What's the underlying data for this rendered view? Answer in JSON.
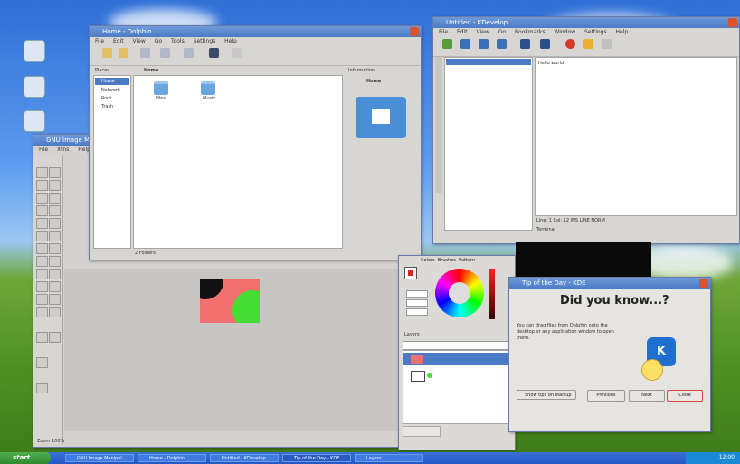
{
  "file_manager": {
    "title": "Home - Dolphin",
    "menu": [
      "File",
      "Edit",
      "View",
      "Go",
      "Tools",
      "Settings",
      "Help"
    ],
    "places": [
      "Home",
      "Network",
      "Root",
      "Trash"
    ],
    "breadcrumb": "Home",
    "items": [
      "Files",
      "Music"
    ],
    "info_title": "Home",
    "info_label": "Information",
    "status": "2 Folders"
  },
  "editor": {
    "title": "Untitled - KDevelop",
    "menu": [
      "File",
      "Edit",
      "View",
      "Go",
      "Bookmarks",
      "Window",
      "Settings",
      "Help"
    ],
    "editor_text": "Hello world",
    "status": "Line: 1 Col: 12 INS LINE NORM"
  },
  "tip_dialog": {
    "title": "Tip of the Day - KDE",
    "heading": "Did you know...?",
    "body": "You can drag files from Dolphin onto the desktop or any application window to open them.",
    "show_tips_label": "Show tips on startup",
    "prev_label": "Previous",
    "next_label": "Next",
    "close_label": "Close"
  },
  "image_editor": {
    "title": "GNU Image Manipulation Program",
    "menu": [
      "File",
      "Xtns",
      "Help"
    ],
    "status": "Zoom 100%"
  },
  "layers_panel": {
    "title": "Layers",
    "tabs": [
      "Colors",
      "Brushes",
      "Pattern"
    ]
  },
  "taskbar": {
    "start_label": "start",
    "tasks": [
      "GNU Image Manipul...",
      "Home - Dolphin",
      "Untitled - KDevelop",
      "Tip of the Day - KDE",
      "Layers"
    ],
    "clock": "12:00"
  },
  "colors": {
    "title_bar": "#4c7bc6",
    "canvas_salmon": "#f07070",
    "canvas_green": "#44dd33",
    "kde_blue": "#1e6fd0"
  }
}
